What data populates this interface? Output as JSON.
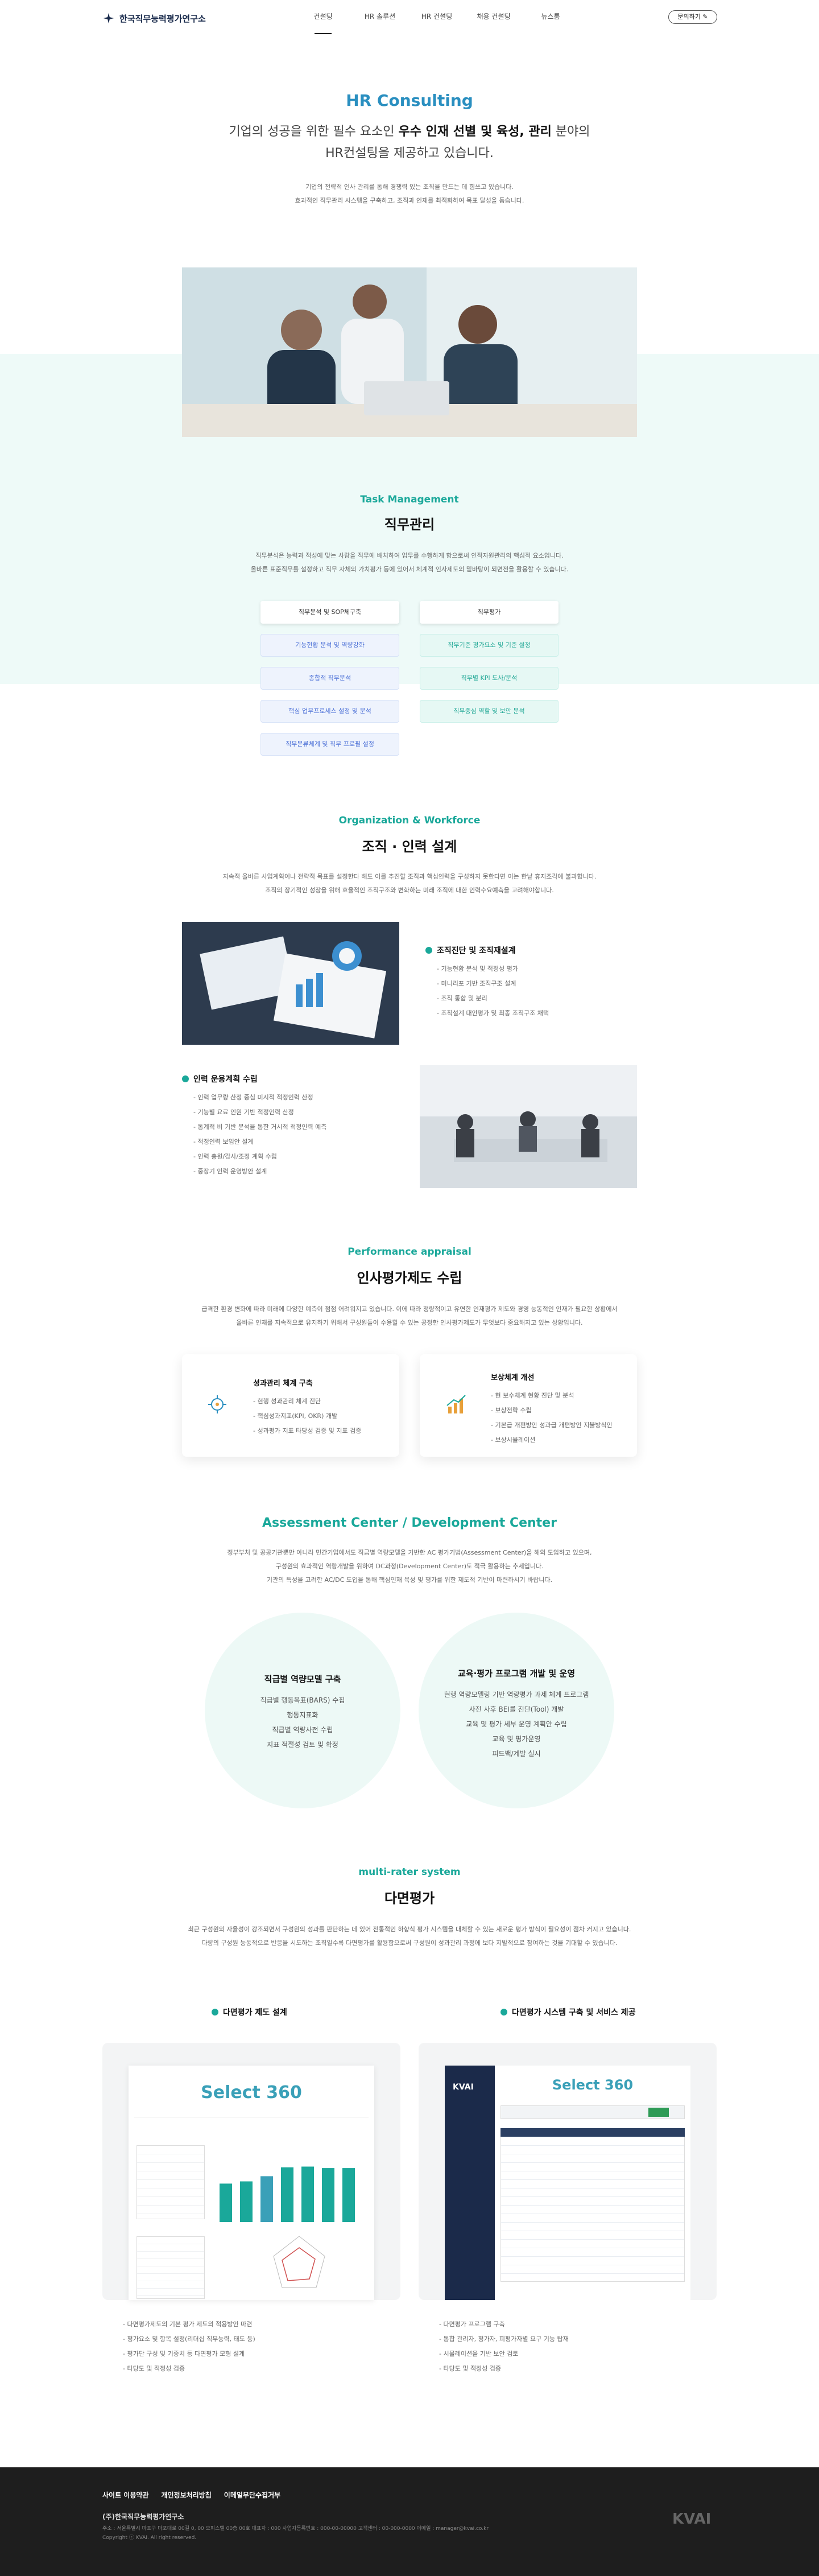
{
  "header": {
    "logo": "한국직무능력평가연구소",
    "nav": [
      "컨설팅",
      "HR 솔루션",
      "HR 컨설팅",
      "채용 컨설팅",
      "뉴스룸"
    ],
    "button": "문의하기"
  },
  "hero": {
    "eng": "HR Consulting",
    "lead1a": "기업의 성공을 위한 필수 요소인 ",
    "lead1b": "우수 인재 선별 및 육성, 관리",
    "lead1c": " 분야의",
    "lead2": "HR컨설팅을 제공하고 있습니다.",
    "p1": "기업의 전략적 인사 관리를 통해 경쟁력 있는 조직을 만드는 데 힘쓰고 있습니다.",
    "p2": "효과적인 직무관리 시스템을 구축하고, 조직과 인재를 최적화하여 목표 달성을 돕습니다."
  },
  "task": {
    "eng": "Task Management",
    "kt": "직무관리",
    "p1": "직무분석은 능력과 적성에 맞는 사람을 직무에 배치하여 업무를 수행하게 함으로써 인적자원관리의 핵심적 요소입니다.",
    "p2": "올바른 표준직무를 설정하고 직무 자체의 가치평가 등에 있어서 체계적 인사제도의 밑바탕이 되면전을 활용할 수 있습니다.",
    "items": [
      {
        "l": "직무분석 및 SOP체구축",
        "s": "dark"
      },
      {
        "l": "직무평가",
        "s": "dark"
      },
      {
        "l": "기능현황 분석 및 역량강화",
        "s": "blue"
      },
      {
        "l": "직무기준 평가요소 및 기준 설정",
        "s": "teal"
      },
      {
        "l": "종합적 직무분석",
        "s": "blue"
      },
      {
        "l": "직무별 KPI 도사/분석",
        "s": "teal"
      },
      {
        "l": "핵심 업무프로세스 설정 및 분석",
        "s": "blue"
      },
      {
        "l": "직무중심 역할 및 보안 분석",
        "s": "teal"
      },
      {
        "l": "직무분류체계 및 직무 프로필 설정",
        "s": "blue"
      }
    ]
  },
  "org": {
    "eng": "Organization & Workforce",
    "kt": "조직 · 인력 설계",
    "p1": "지속적 올바른 사업계획이나 전략적 목표를 설정한다 해도 이를 추진할 조직과 핵심인력을 구성하지 못한다면 이는 한낱 휴지조각에 불과합니다.",
    "p2": "조직의 장기적인 성장을 위해 효율적인 조직구조와 변화하는 미래 조직에 대한 인력수요예측을 고려해야합니다.",
    "h1": "조직진단 및 조직재설계",
    "l1": [
      "기능현황 분석 및 적정성 평가",
      "미니리포 기반 조직구조 설계",
      "조직 통합 및 분리",
      "조직설계 대안평가 및 최종 조직구조 채택"
    ],
    "h2": "인력 운용계획 수립",
    "l2": [
      "인력 업무량 산정 중심 미시적 적정인력 산정",
      "기능별 요료 인원 기반 적정인력 산정",
      "통계적 비 기반 분석을 통한 거시적 적정인력 예측",
      "적정인력 보임안 설계",
      "인력 충원/감사/조정 계획 수립",
      "중장기 인력 운영방안 설계"
    ]
  },
  "perf": {
    "eng": "Performance appraisal",
    "kt": "인사평가제도 수립",
    "p1": "급격한 환경 변화에 따라 미래에 다양한 예측이 점점 어려워지고 있습니다. 이에 따라 정량적이고 유연한 인재평가 제도와 경영 능동적인 인재가 필요한 상황에서",
    "p2": "올바른 인재를 지속적으로 유지하기 위해서 구성원들이 수용할 수 있는 공정한 인사평가제도가 무엇보다 중요해지고 있는 상황입니다.",
    "c1": {
      "t": "성과관리 체계 구축",
      "l": [
        "현행 성과관리 체계 진단",
        "핵심성과지표(KPI, OKR) 개발",
        "성과평가 지표 타당성 검증 및 지표 검증"
      ]
    },
    "c2": {
      "t": "보상체계 개선",
      "l": [
        "현 보수체계 현황 진단 및 분석",
        "보상전략 수립",
        "기본급 개편방안 성과급 개편방안 지불방식안",
        "보상시뮬레이션"
      ]
    }
  },
  "ac": {
    "eng": "Assessment Center / Development Center",
    "p1": "정부부처 및 공공기관뿐만 아니라 민간기업에서도 직급별 역량모델을 기반한 AC 평가기법(Assessment Center)을 해외 도입하고 있으며,",
    "p2": "구성원의 효과적인 역량개발을 위하여 DC과정(Development Center)도 적극 활용하는 추세입니다.",
    "p3": "기관의 특성을 고려한 AC/DC 도입을 통해 핵심인재 육성 및 평가를 위한 제도적 기반이 마련하시기 바랍니다.",
    "c1": {
      "t": "직급별 역량모델 구축",
      "l": [
        "직급별 행동목표(BARS) 수집",
        "행동지표화",
        "직급별 역량사전 수립",
        "지표 적절성 검토 및 확정"
      ]
    },
    "c2": {
      "t": "교육·평가 프로그램 개발 및 운영",
      "l": [
        "현행 역량모델링 기반 역량평가 과제 체계 프로그램",
        "사전 사후 BEI를 진단(Tool) 개발",
        "교육 및 평가 세부 운영 계획안 수립",
        "교육 및 평가운영",
        "피드백/계발 실시"
      ]
    }
  },
  "multi": {
    "eng": "multi-rater system",
    "kt": "다면평가",
    "p1": "최근 구성원의 자율성이 강조되면서 구성원의 성과를 판단하는 데 있어 전통적인 하향식 평가 시스템을 대체할 수 있는 새로운 평가 방식이 필요성이 점차 커지고 있습니다.",
    "p2": "다량의 구성원 능동적으로 반응을 시도하는 조직일수록 다면평가를 활용함으로써 구성원이 성과관리 과정에 보다 지발적으로 참여하는 것을 기대할 수 있습니다.",
    "h1": "다면평가 제도 설계",
    "h2": "다면평가 시스템 구축 및 서비스 제공",
    "brand": "Select 360",
    "kvai": "KVAI",
    "l1": [
      "다면평가제도의 기본 평가 제도의 적용방안 마련",
      "평가요소 및 항목 설정(리더십 직무능력, 태도 등)",
      "평가단 구성 및 기중치 등 다면평가 모형 설계",
      "타당도 및 적정성 검증"
    ],
    "l2": [
      "다면평가 프로그램 구축",
      "통합 관리자, 평가자, 피평가자별 요구 기능 탑재",
      "시뮬레이션을 기반 보안 검토",
      "타당도 및 적정성 검증"
    ],
    "bars": [
      0.52,
      0.55,
      0.62,
      0.74,
      0.75,
      0.73,
      0.73
    ]
  },
  "footer": {
    "links": [
      "사이트 이용약관",
      "개인정보처리방침",
      "이메일무단수집거부"
    ],
    "company": "(주)한국직무능력평가연구소",
    "addr": "주소 : 서울특별시 마포구 마포대로 00길 0, 00 오피스텔 00층 00호   대표자 : 000   사업자등록번호 : 000-00-00000   고객센터 : 00-000-0000   이메일 : manager@kvai.co.kr",
    "copy": "Copyright ⓒ KVAI. All right reserved.",
    "logo": "KVAI"
  },
  "colors": {
    "teal": "#1aa89a",
    "blue": "#2a8fc0",
    "mint": "#eefaf8",
    "footer": "#1e1e1e"
  }
}
